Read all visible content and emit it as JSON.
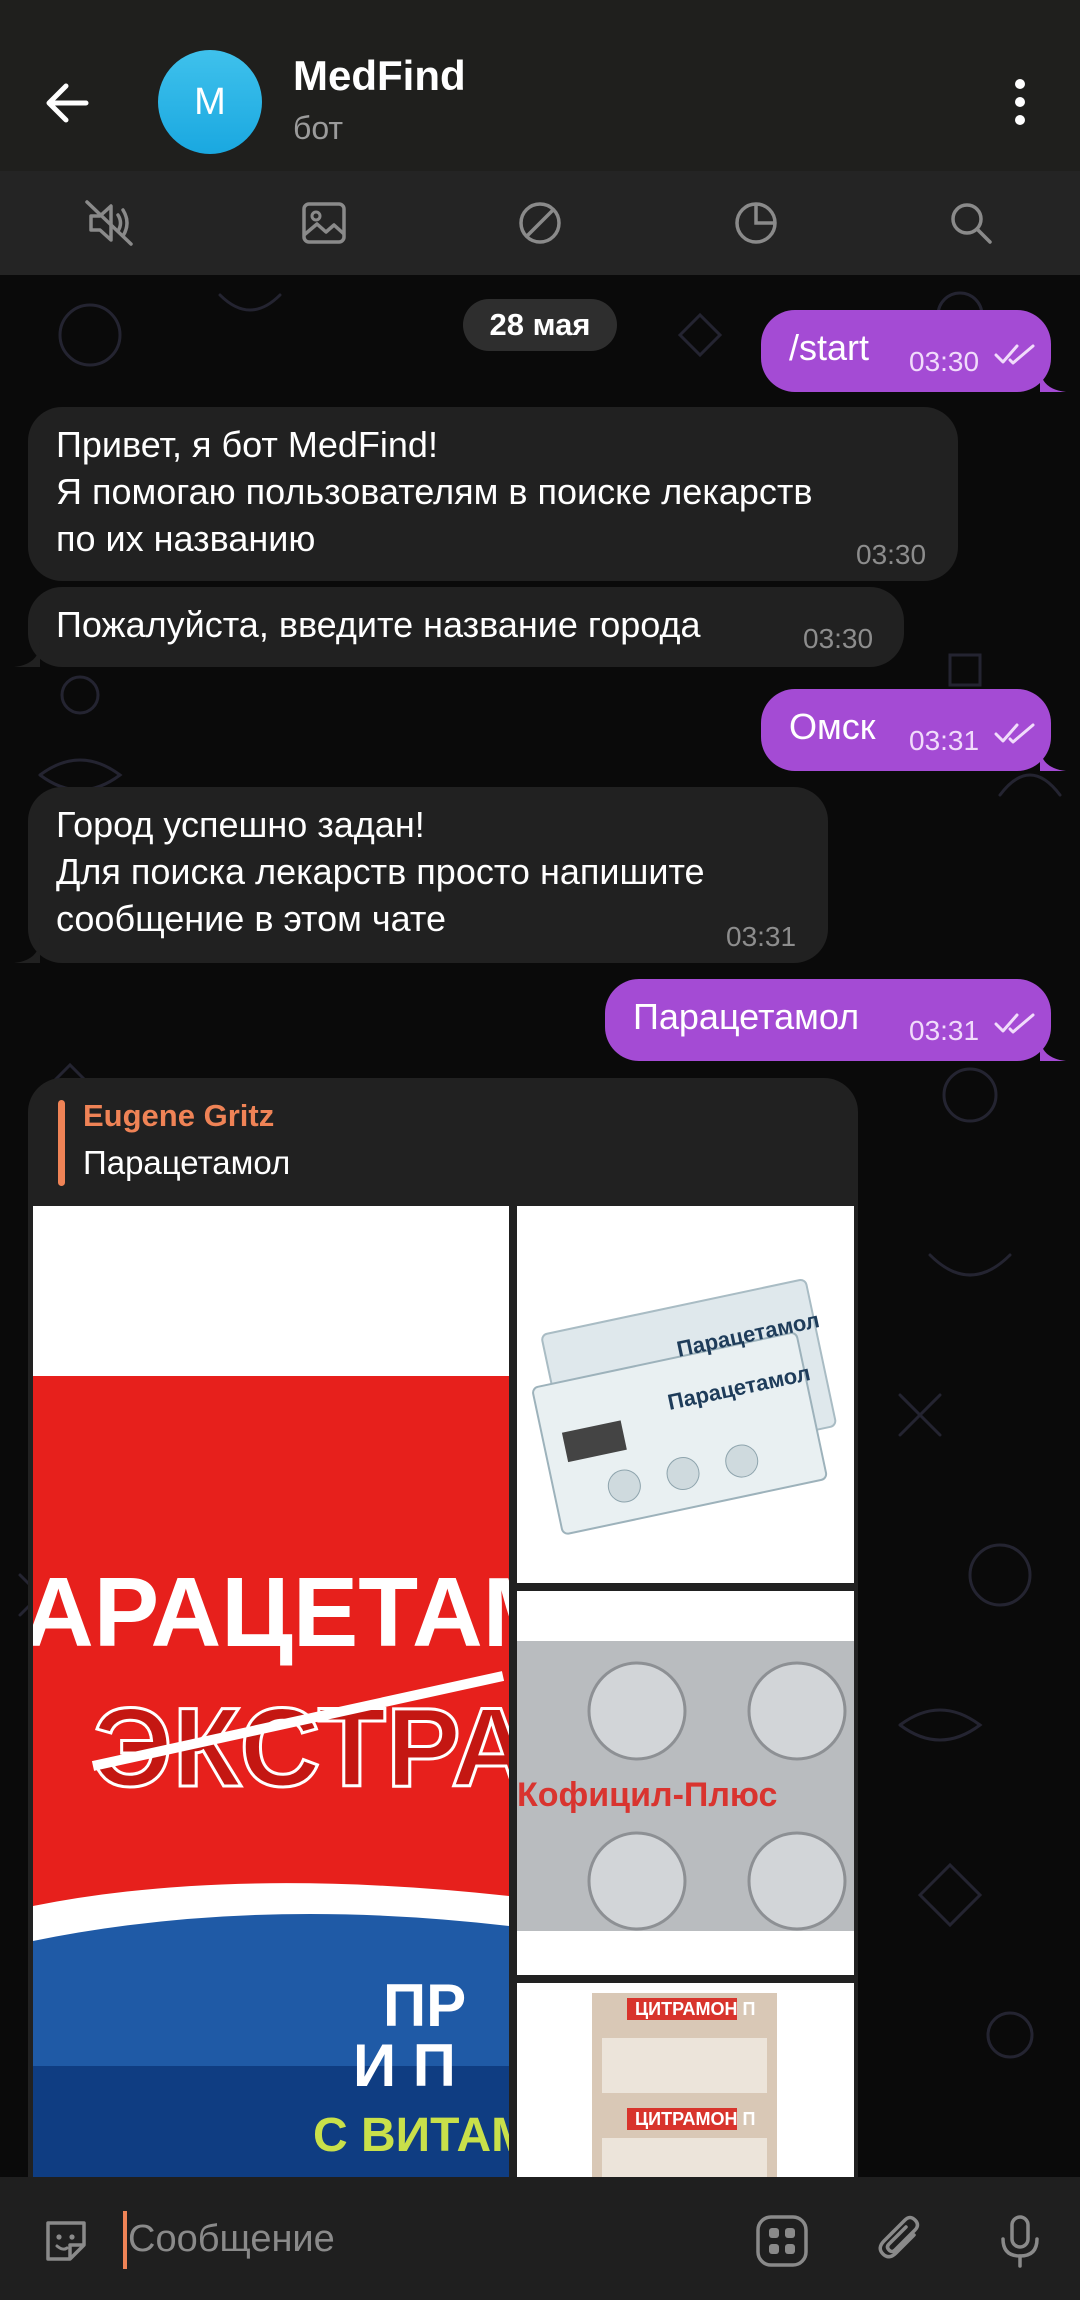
{
  "header": {
    "avatar_letter": "M",
    "title": "MedFind",
    "subtitle": "бот",
    "back_icon": "arrow-left-icon",
    "menu_icon": "more-vertical-icon"
  },
  "toolbar": {
    "items": [
      {
        "name": "mute-icon"
      },
      {
        "name": "media-icon"
      },
      {
        "name": "block-icon"
      },
      {
        "name": "auto-delete-timer-icon"
      },
      {
        "name": "search-icon"
      }
    ]
  },
  "chat": {
    "date_label": "28 мая",
    "messages": [
      {
        "dir": "out",
        "text": "/start",
        "time": "03:30",
        "status": "read"
      },
      {
        "dir": "in",
        "text": "Привет, я бот MedFind!\nЯ помогаю пользователям в поиске лекарств\nпо их названию",
        "time": "03:30"
      },
      {
        "dir": "in",
        "text": "Пожалуйста, введите название города",
        "time": "03:30"
      },
      {
        "dir": "out",
        "text": "Омск",
        "time": "03:31",
        "status": "read"
      },
      {
        "dir": "in",
        "text": "Город успешно задан!\nДля поиска лекарств просто напишите\nсообщение в этом чате",
        "time": "03:31"
      },
      {
        "dir": "out",
        "text": "Парацетамол",
        "time": "03:31",
        "status": "read"
      }
    ],
    "media_message": {
      "reply_author": "Eugene Gritz",
      "reply_text": "Парацетамол",
      "photos": [
        {
          "label": "photo-paracetamol-extra-box",
          "text": "АРАЦЕТАМ ЭКСТРА"
        },
        {
          "label": "photo-paracetamol-blister",
          "text": "Парацетамол"
        },
        {
          "label": "photo-kofitsil-plus-blister",
          "text": "Кофицил-Плюс"
        },
        {
          "label": "photo-tsitramon-blister",
          "text": "ЦИТРАМОН П"
        }
      ]
    }
  },
  "input": {
    "placeholder": "Сообщение",
    "emoji_icon": "sticker-emoji-icon",
    "bot_menu_icon": "bot-commands-icon",
    "attach_icon": "paperclip-icon",
    "mic_icon": "microphone-icon"
  },
  "colors": {
    "header_bg": "#1f1f1d",
    "outgoing_bubble": "#a44bd4",
    "incoming_bubble": "#212121",
    "accent": "#ef8356",
    "avatar": "#1aa8e0"
  }
}
